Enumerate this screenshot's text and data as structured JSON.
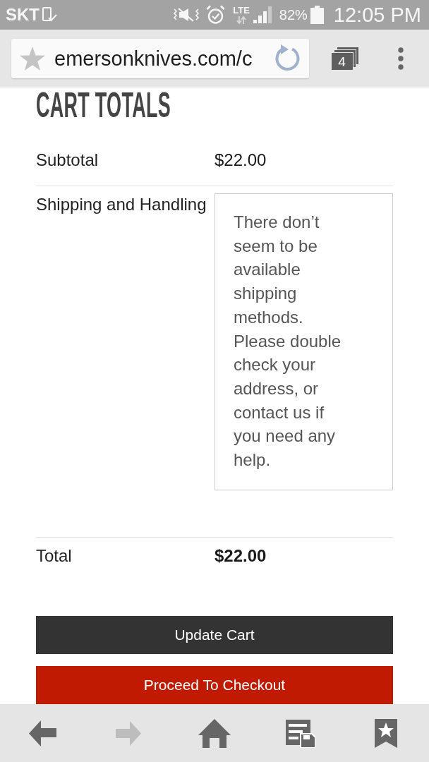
{
  "status_bar": {
    "carrier": "SKT",
    "network": "LTE",
    "battery": "82%",
    "time": "12:05 PM"
  },
  "browser_toolbar": {
    "url": "emersonknives.com/c",
    "tab_count": "4"
  },
  "cart_totals": {
    "title": "CART TOTALS",
    "rows": [
      {
        "kind": "amount",
        "label": "Subtotal",
        "value": "$22.00"
      },
      {
        "kind": "notice",
        "label": "Shipping and Handling",
        "message": "There don’t seem to be available shipping methods. Please double check your address, or contact us if you need any help."
      },
      {
        "kind": "total",
        "label": "Total",
        "value": "$22.00"
      }
    ]
  },
  "buttons": [
    {
      "kind": "secondary",
      "label": "Update Cart"
    },
    {
      "kind": "primary",
      "label": "Proceed To Checkout"
    }
  ],
  "bottom_nav": [
    {
      "kind": "back",
      "disabled": false
    },
    {
      "kind": "forward",
      "disabled": true
    },
    {
      "kind": "home",
      "disabled": false
    },
    {
      "kind": "reading_list",
      "disabled": false
    },
    {
      "kind": "bookmarks",
      "disabled": false
    }
  ]
}
